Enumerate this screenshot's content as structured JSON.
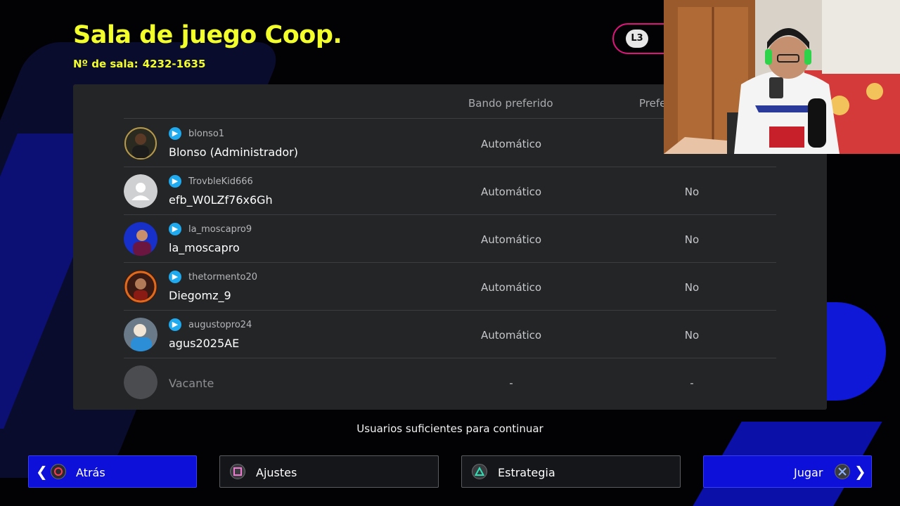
{
  "header": {
    "title": "Sala de juego Coop.",
    "room_label": "Nº de sala:",
    "room_number": "4232-1635",
    "l3_label": "L3"
  },
  "table": {
    "columns": [
      "Bando preferido",
      "Prefe"
    ],
    "rows": [
      {
        "psn": "blonso1",
        "name": "Blonso (Administrador)",
        "side": "Automático",
        "pref": ""
      },
      {
        "psn": "TrovbleKid666",
        "name": "efb_W0LZf76x6Gh",
        "side": "Automático",
        "pref": "No"
      },
      {
        "psn": "la_moscapro9",
        "name": "la_moscapro",
        "side": "Automático",
        "pref": "No"
      },
      {
        "psn": "thetormento20",
        "name": "Diegomz_9",
        "side": "Automático",
        "pref": "No"
      },
      {
        "psn": "augustopro24",
        "name": "agus2025AE",
        "side": "Automático",
        "pref": "No"
      }
    ],
    "vacant": {
      "name": "Vacante",
      "side": "-",
      "pref": "-"
    }
  },
  "status": "Usuarios suficientes para continuar",
  "buttons": {
    "back": "Atrás",
    "settings": "Ajustes",
    "strategy": "Estrategia",
    "play": "Jugar"
  },
  "colors": {
    "accent_yellow": "#f3ff2a",
    "button_blue": "#0d10d8",
    "psn_blue": "#1fa9ee",
    "panel": "#232527",
    "pink_outline": "#e0157c"
  }
}
